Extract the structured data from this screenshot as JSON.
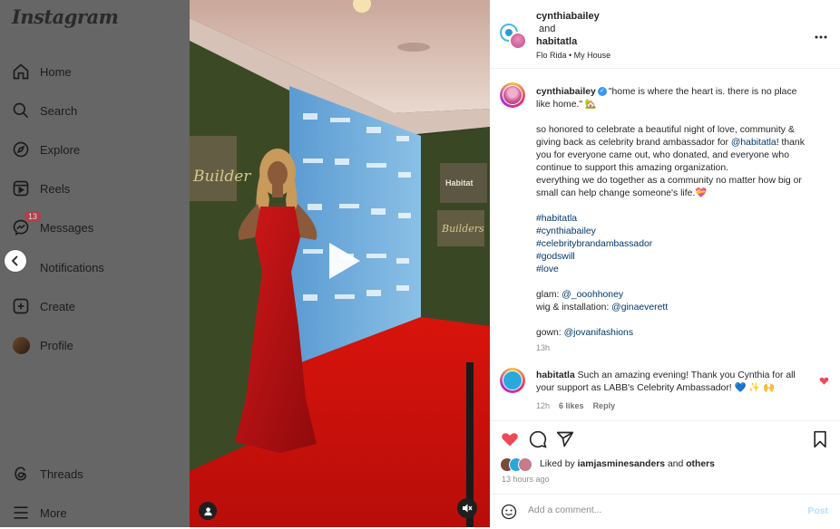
{
  "sidebar": {
    "brand": "Instagram",
    "items": [
      {
        "label": "Home",
        "icon": "home-icon"
      },
      {
        "label": "Search",
        "icon": "search-icon"
      },
      {
        "label": "Explore",
        "icon": "compass-icon"
      },
      {
        "label": "Reels",
        "icon": "reels-icon"
      },
      {
        "label": "Messages",
        "icon": "messenger-icon",
        "badge": "13"
      },
      {
        "label": "Notifications",
        "icon": "heart-icon"
      },
      {
        "label": "Create",
        "icon": "plus-square-icon"
      },
      {
        "label": "Profile",
        "icon": "avatar"
      },
      {
        "label": "Threads",
        "icon": "threads-icon"
      },
      {
        "label": "More",
        "icon": "menu-icon"
      }
    ]
  },
  "post": {
    "author": "cynthiabailey",
    "collab_joiner": "and",
    "collaborator": "habitatla",
    "audio": "Flo Rida • My House",
    "caption_quote": "\"home is where the heart is. there is no place like home.\" 🏡",
    "caption_p1_before": "so honored to celebrate a beautiful night of love, community & giving back as celebrity brand ambassador for ",
    "caption_p1_mention": "@habitatla",
    "caption_p1_after": "! thank you for everyone came out, who donated, and everyone who continue to support this amazing organization.",
    "caption_p2": "everything we do together as a community no matter how big or small can help change someone's life.💝",
    "hashtags": [
      "#habitatla",
      "#cynthiabailey",
      "#celebritybrandambassador",
      "#godswill",
      "#love"
    ],
    "glam_label": "glam: ",
    "glam_mention": "@_ooohhoney",
    "wig_label": "wig & installation: ",
    "wig_mention": "@ginaeverett",
    "gown_label": "gown: ",
    "gown_mention": "@jovanifashions",
    "caption_time": "13h",
    "liked_prefix": "Liked by",
    "liked_user": "iamjasminesanders",
    "liked_and": "and",
    "liked_others": "others",
    "time_ago": "13 hours ago"
  },
  "comment": {
    "user": "habitatla",
    "text": "Such an amazing evening! Thank you Cynthia for all your support as LABB's Celebrity Ambassador! 💙 ✨ 🙌",
    "time": "12h",
    "likes": "6 likes",
    "reply": "Reply"
  },
  "composer": {
    "placeholder": "Add a comment...",
    "post_label": "Post"
  },
  "colors": {
    "like_red": "#ed4956",
    "link_blue": "#00376b",
    "verified_blue": "#3897f0",
    "carpet_red": "#c8140e"
  }
}
